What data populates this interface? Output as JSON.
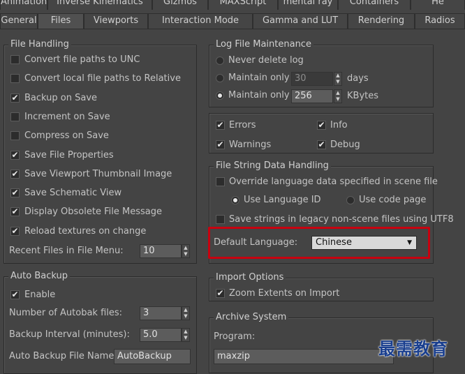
{
  "tabs_row1": [
    "Animation",
    "Inverse Kinematics",
    "Gizmos",
    "MAXScript",
    "mental ray",
    "Containers",
    "He"
  ],
  "tabs_row2": [
    "General",
    "Files",
    "Viewports",
    "Interaction Mode",
    "Gamma and LUT",
    "Rendering",
    "Radios"
  ],
  "file_handling": {
    "title": "File Handling",
    "options": [
      {
        "label": "Convert file paths to UNC",
        "checked": false
      },
      {
        "label": "Convert local file paths to Relative",
        "checked": false
      },
      {
        "label": "Backup on Save",
        "checked": true
      },
      {
        "label": "Increment on Save",
        "checked": false
      },
      {
        "label": "Compress on Save",
        "checked": false
      },
      {
        "label": "Save File Properties",
        "checked": true
      },
      {
        "label": "Save Viewport Thumbnail Image",
        "checked": true
      },
      {
        "label": "Save Schematic View",
        "checked": true
      },
      {
        "label": "Display Obsolete File Message",
        "checked": true
      },
      {
        "label": "Reload textures on change",
        "checked": true
      }
    ],
    "recent_files_label": "Recent Files in File Menu:",
    "recent_files_value": "10"
  },
  "auto_backup": {
    "title": "Auto Backup",
    "enable_label": "Enable",
    "enable_checked": true,
    "num_files_label": "Number of Autobak files:",
    "num_files_value": "3",
    "interval_label": "Backup Interval (minutes):",
    "interval_value": "5.0",
    "file_name_label": "Auto Backup File Name:",
    "file_name_value": "AutoBackup"
  },
  "log_maintenance": {
    "title": "Log File Maintenance",
    "never_delete_label": "Never delete log",
    "maintain_days_label": "Maintain only",
    "maintain_days_value": "30",
    "days_unit": "days",
    "maintain_kb_label": "Maintain only",
    "maintain_kb_value": "256",
    "kb_unit": "KBytes",
    "selected": "kbytes",
    "errors_label": "Errors",
    "info_label": "Info",
    "warnings_label": "Warnings",
    "debug_label": "Debug"
  },
  "file_string": {
    "title": "File String Data Handling",
    "override_label": "Override language data specified in scene file",
    "use_language_id_label": "Use Language ID",
    "use_code_page_label": "Use code page",
    "save_utf8_label": "Save strings in legacy non-scene files using UTF8",
    "default_language_label": "Default Language:",
    "default_language_value": "Chinese"
  },
  "import_options": {
    "title": "Import Options",
    "zoom_extents_label": "Zoom Extents on Import"
  },
  "archive_system": {
    "title": "Archive System",
    "program_label": "Program:",
    "program_value": "maxzip"
  },
  "watermark": "最需教育",
  "colors": {
    "highlight": "#c8000f",
    "background": "#444444"
  }
}
